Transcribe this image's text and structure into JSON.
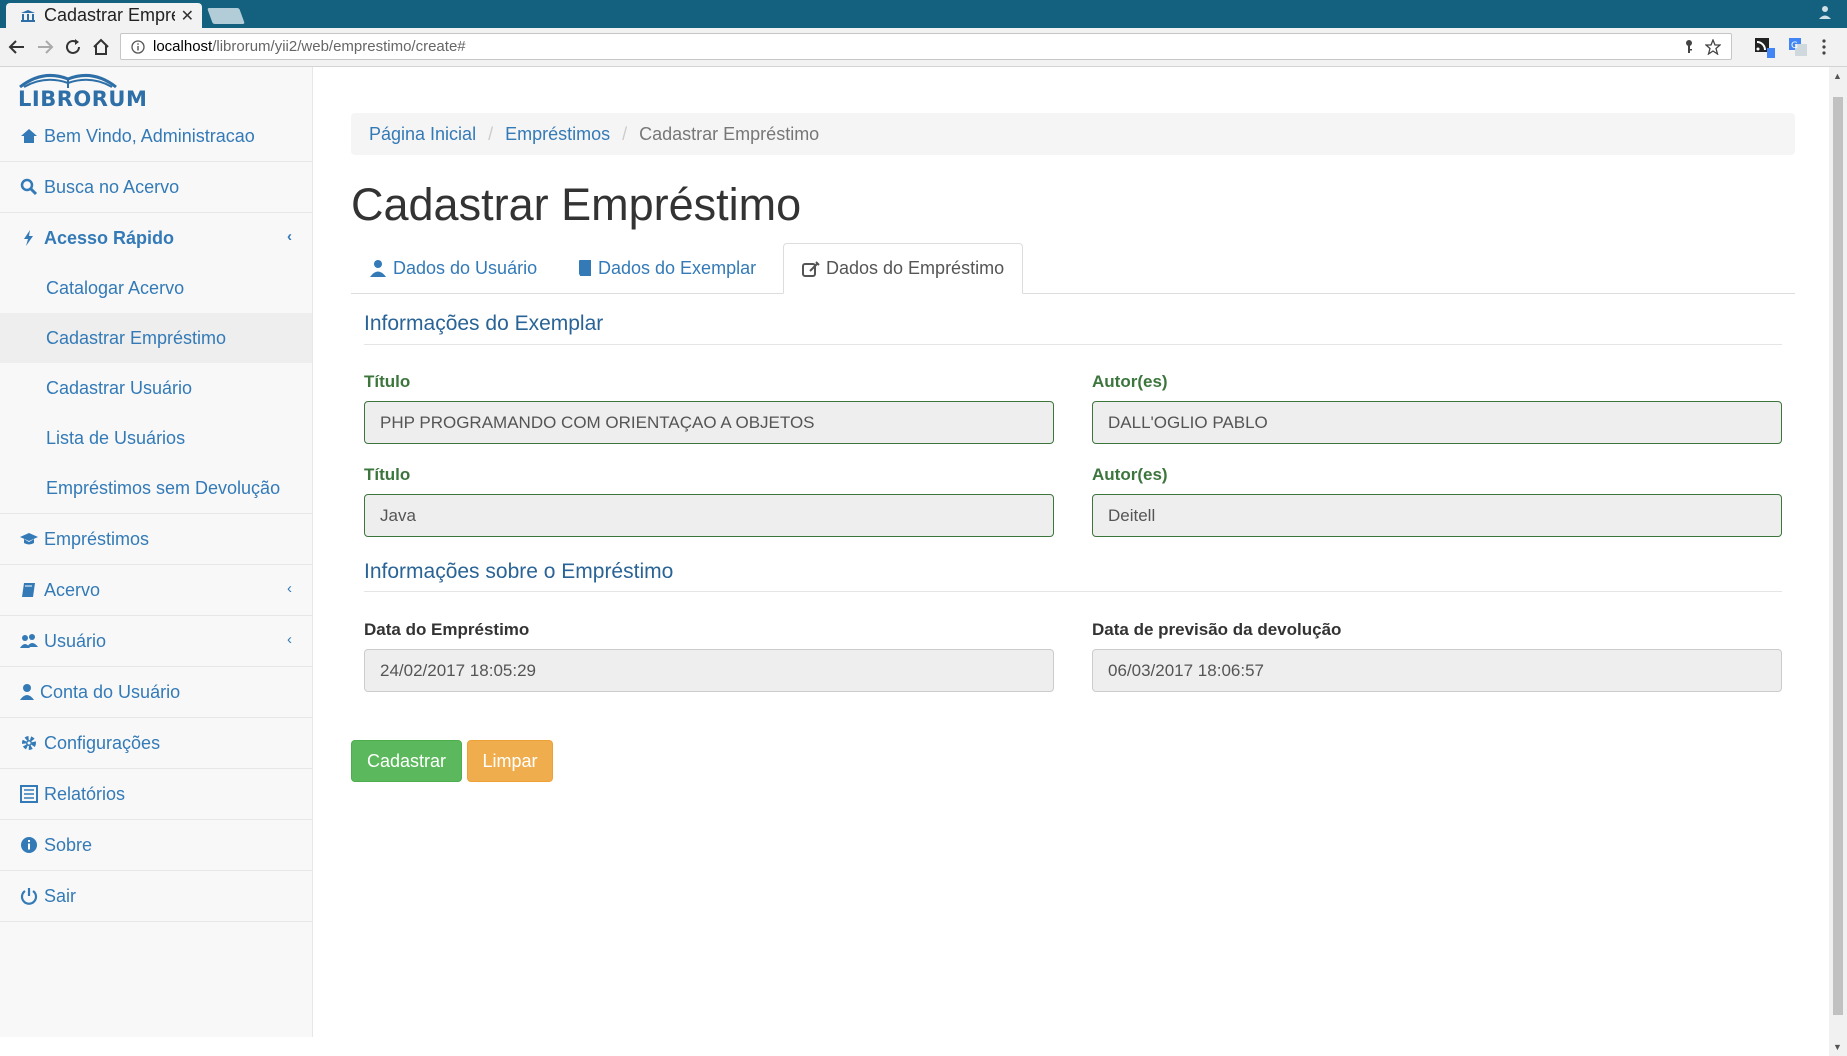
{
  "browser": {
    "tab_title": "Cadastrar Empréstimo",
    "url_host": "localhost",
    "url_path": "/librorum/yii2/web/emprestimo/create#"
  },
  "logo": {
    "text": "LIBRORUM"
  },
  "sidebar": {
    "items": [
      {
        "label": "Bem Vindo, Administracao",
        "icon": "home-icon"
      },
      {
        "label": "Busca no Acervo",
        "icon": "search-icon"
      },
      {
        "label": "Acesso Rápido",
        "icon": "bolt-icon",
        "expanded": true,
        "children": [
          {
            "label": "Catalogar Acervo"
          },
          {
            "label": "Cadastrar Empréstimo",
            "active": true
          },
          {
            "label": "Cadastrar Usuário"
          },
          {
            "label": "Lista de Usuários"
          },
          {
            "label": "Empréstimos sem Devolução"
          }
        ]
      },
      {
        "label": "Empréstimos",
        "icon": "graduation-cap-icon"
      },
      {
        "label": "Acervo",
        "icon": "book-icon"
      },
      {
        "label": "Usuário",
        "icon": "users-icon"
      },
      {
        "label": "Conta do Usuário",
        "icon": "user-icon"
      },
      {
        "label": "Configurações",
        "icon": "gear-icon"
      },
      {
        "label": "Relatórios",
        "icon": "list-icon"
      },
      {
        "label": "Sobre",
        "icon": "info-icon"
      },
      {
        "label": "Sair",
        "icon": "power-icon"
      }
    ]
  },
  "breadcrumb": {
    "home": "Página Inicial",
    "parent": "Empréstimos",
    "current": "Cadastrar Empréstimo"
  },
  "page_title": "Cadastrar Empréstimo",
  "tabs": [
    {
      "label": "Dados do Usuário",
      "active": false
    },
    {
      "label": "Dados do Exemplar",
      "active": false
    },
    {
      "label": "Dados do Empréstimo",
      "active": true
    }
  ],
  "exemplar_section": {
    "title": "Informações do Exemplar",
    "rows": [
      {
        "titulo_label": "Título",
        "titulo_value": "PHP PROGRAMANDO COM ORIENTAÇAO A OBJETOS",
        "autor_label": "Autor(es)",
        "autor_value": "DALL'OGLIO PABLO"
      },
      {
        "titulo_label": "Título",
        "titulo_value": "Java",
        "autor_label": "Autor(es)",
        "autor_value": "Deitell"
      }
    ]
  },
  "emprestimo_section": {
    "title": "Informações sobre o Empréstimo",
    "data_label": "Data do Empréstimo",
    "data_value": "24/02/2017 18:05:29",
    "previsao_label": "Data de previsão da devolução",
    "previsao_value": "06/03/2017 18:06:57"
  },
  "buttons": {
    "submit": "Cadastrar",
    "reset": "Limpar"
  },
  "colors": {
    "link": "#337ab7",
    "success": "#5cb85c",
    "warning": "#f0ad4e",
    "valid": "#3c763d",
    "chrome": "#13617e"
  }
}
